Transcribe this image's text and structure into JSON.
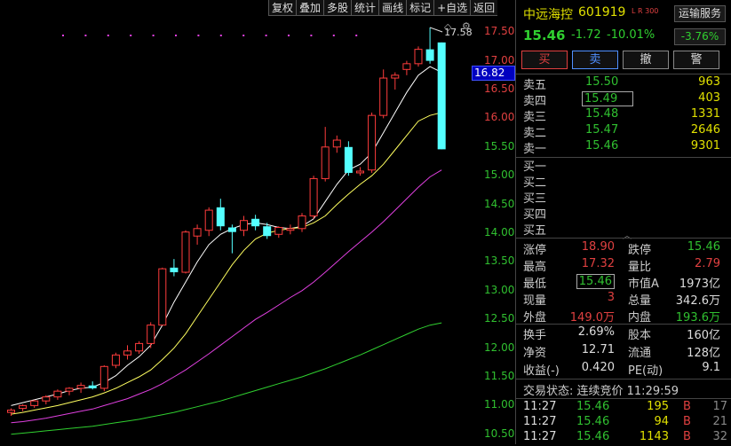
{
  "toolbar": [
    "复权",
    "叠加",
    "多股",
    "统计",
    "画线",
    "标记",
    "+自选",
    "返回"
  ],
  "y_axis": [
    {
      "label": "17.50",
      "value": 17.5
    },
    {
      "label": "17.00",
      "value": 17.0
    },
    {
      "label": "16.50",
      "value": 16.5
    },
    {
      "label": "16.00",
      "value": 16.0
    },
    {
      "label": "15.50",
      "value": 15.5
    },
    {
      "label": "15.00",
      "value": 15.0
    },
    {
      "label": "14.50",
      "value": 14.5
    },
    {
      "label": "14.00",
      "value": 14.0
    },
    {
      "label": "13.50",
      "value": 13.5
    },
    {
      "label": "13.00",
      "value": 13.0
    },
    {
      "label": "12.50",
      "value": 12.5
    },
    {
      "label": "12.00",
      "value": 12.0
    },
    {
      "label": "11.50",
      "value": 11.5
    },
    {
      "label": "11.00",
      "value": 11.0
    },
    {
      "label": "10.50",
      "value": 10.5
    }
  ],
  "current_price_label": "16.82",
  "high_marker": "17.58",
  "chart_data": {
    "type": "candlestick",
    "candles": [
      [
        10.88,
        10.95,
        10.82,
        10.92
      ],
      [
        10.95,
        11.02,
        10.9,
        11.0
      ],
      [
        11.0,
        11.1,
        10.96,
        11.08
      ],
      [
        11.08,
        11.18,
        11.02,
        11.15
      ],
      [
        11.15,
        11.28,
        11.1,
        11.25
      ],
      [
        11.25,
        11.32,
        11.18,
        11.3
      ],
      [
        11.3,
        11.4,
        11.22,
        11.35
      ],
      [
        11.35,
        11.42,
        11.28,
        11.3
      ],
      [
        11.3,
        11.7,
        11.25,
        11.68
      ],
      [
        11.7,
        11.92,
        11.65,
        11.88
      ],
      [
        11.88,
        12.05,
        11.8,
        11.95
      ],
      [
        11.95,
        12.12,
        11.9,
        12.08
      ],
      [
        12.08,
        12.45,
        12.0,
        12.4
      ],
      [
        12.4,
        13.4,
        12.4,
        13.38
      ],
      [
        13.4,
        13.55,
        13.25,
        13.32
      ],
      [
        13.32,
        14.05,
        13.3,
        14.02
      ],
      [
        13.95,
        14.15,
        13.8,
        14.08
      ],
      [
        14.05,
        14.45,
        13.95,
        14.4
      ],
      [
        14.45,
        14.6,
        14.05,
        14.12
      ],
      [
        14.1,
        14.15,
        13.65,
        14.02
      ],
      [
        14.05,
        14.3,
        13.95,
        14.22
      ],
      [
        14.25,
        14.32,
        14.05,
        14.12
      ],
      [
        14.12,
        14.18,
        13.9,
        13.95
      ],
      [
        13.98,
        14.12,
        13.92,
        14.1
      ],
      [
        14.05,
        14.15,
        13.98,
        14.08
      ],
      [
        14.08,
        14.35,
        14.02,
        14.3
      ],
      [
        14.3,
        15.0,
        14.25,
        14.95
      ],
      [
        14.95,
        15.85,
        14.9,
        15.5
      ],
      [
        15.5,
        15.7,
        15.4,
        15.62
      ],
      [
        15.5,
        15.6,
        15.0,
        15.05
      ],
      [
        15.05,
        15.15,
        15.0,
        15.08
      ],
      [
        15.1,
        16.1,
        15.05,
        16.05
      ],
      [
        16.05,
        16.85,
        16.0,
        16.7
      ],
      [
        16.7,
        16.8,
        16.5,
        16.75
      ],
      [
        16.85,
        17.0,
        16.75,
        16.95
      ],
      [
        16.95,
        17.25,
        16.9,
        17.2
      ],
      [
        17.2,
        17.58,
        16.95,
        17.0
      ],
      [
        17.32,
        17.32,
        15.46,
        15.46
      ]
    ],
    "ma": [
      {
        "name": "MA5",
        "color": "#ffffff",
        "values": [
          11.0,
          11.05,
          11.1,
          11.15,
          11.2,
          11.26,
          11.3,
          11.32,
          11.4,
          11.52,
          11.7,
          11.85,
          12.05,
          12.4,
          12.8,
          13.15,
          13.5,
          13.8,
          13.98,
          14.08,
          14.15,
          14.18,
          14.15,
          14.1,
          14.08,
          14.12,
          14.25,
          14.55,
          14.85,
          15.1,
          15.2,
          15.4,
          15.75,
          16.1,
          16.45,
          16.75,
          16.9,
          16.8
        ]
      },
      {
        "name": "MA10",
        "color": "#ffff60",
        "values": [
          10.85,
          10.88,
          10.92,
          10.96,
          11.0,
          11.05,
          11.1,
          11.15,
          11.22,
          11.3,
          11.4,
          11.5,
          11.62,
          11.8,
          12.0,
          12.25,
          12.55,
          12.85,
          13.15,
          13.45,
          13.7,
          13.9,
          14.0,
          14.05,
          14.08,
          14.1,
          14.18,
          14.3,
          14.5,
          14.68,
          14.85,
          15.0,
          15.2,
          15.45,
          15.7,
          15.95,
          16.05,
          16.1
        ]
      },
      {
        "name": "MA20",
        "color": "#e040e0",
        "values": [
          10.7,
          10.72,
          10.75,
          10.78,
          10.82,
          10.86,
          10.9,
          10.94,
          11.0,
          11.06,
          11.12,
          11.2,
          11.28,
          11.38,
          11.5,
          11.62,
          11.76,
          11.9,
          12.05,
          12.2,
          12.35,
          12.5,
          12.62,
          12.75,
          12.88,
          13.0,
          13.15,
          13.32,
          13.5,
          13.68,
          13.85,
          14.02,
          14.2,
          14.4,
          14.6,
          14.8,
          14.98,
          15.1
        ]
      },
      {
        "name": "MA60",
        "color": "#30d030",
        "values": [
          10.5,
          10.52,
          10.54,
          10.56,
          10.58,
          10.6,
          10.62,
          10.64,
          10.67,
          10.7,
          10.73,
          10.76,
          10.8,
          10.84,
          10.88,
          10.93,
          10.98,
          11.03,
          11.08,
          11.14,
          11.2,
          11.26,
          11.32,
          11.38,
          11.44,
          11.5,
          11.57,
          11.64,
          11.72,
          11.8,
          11.88,
          11.97,
          12.06,
          12.15,
          12.24,
          12.33,
          12.4,
          12.44
        ]
      }
    ],
    "ylim": [
      10.45,
      17.75
    ]
  },
  "stock": {
    "name": "中远海控",
    "code": "601919",
    "tags": "L R 300",
    "industry": "运输服务",
    "industry_pct": "-3.76%"
  },
  "quote": {
    "price": "15.46",
    "change": "-1.72",
    "pct": "-10.01%"
  },
  "buttons": [
    "买",
    "卖",
    "撤",
    "警"
  ],
  "sell_orders": [
    {
      "label": "卖五",
      "price": "15.50",
      "vol": "963"
    },
    {
      "label": "卖四",
      "price": "15.49",
      "vol": "403"
    },
    {
      "label": "卖三",
      "price": "15.48",
      "vol": "1331"
    },
    {
      "label": "卖二",
      "price": "15.47",
      "vol": "2646"
    },
    {
      "label": "卖一",
      "price": "15.46",
      "vol": "9301"
    }
  ],
  "buy_orders": [
    "买一",
    "买二",
    "买三",
    "买四",
    "买五"
  ],
  "stats": [
    {
      "l1": "涨停",
      "v1": "18.90",
      "c1": "red",
      "l2": "跌停",
      "v2": "15.46",
      "c2": "val"
    },
    {
      "l1": "最高",
      "v1": "17.32",
      "c1": "red",
      "l2": "量比",
      "v2": "2.79",
      "c2": "red"
    },
    {
      "l1": "最低",
      "v1": "15.46",
      "c1": "val",
      "l2": "市值A",
      "v2": "1973亿",
      "c2": "wht"
    },
    {
      "l1": "现量",
      "v1": "3",
      "c1": "red",
      "l2": "总量",
      "v2": "342.6万",
      "c2": "wht"
    },
    {
      "l1": "外盘",
      "v1": "149.0万",
      "c1": "red",
      "l2": "内盘",
      "v2": "193.6万",
      "c2": "val"
    }
  ],
  "stats2": [
    {
      "l1": "换手",
      "v1": "2.69%",
      "l2": "股本",
      "v2": "160亿"
    },
    {
      "l1": "净资",
      "v1": "12.71",
      "l2": "流通",
      "v2": "128亿"
    },
    {
      "l1": "收益(-)",
      "v1": "0.420",
      "l2": "PE(动)",
      "v2": "9.1"
    }
  ],
  "trade_status": "交易状态: 连续竞价 11:29:59",
  "ticks": [
    {
      "time": "11:27",
      "price": "15.46",
      "vol": "195",
      "side": "B",
      "n": "17"
    },
    {
      "time": "11:27",
      "price": "15.46",
      "vol": "94",
      "side": "B",
      "n": "21"
    },
    {
      "time": "11:27",
      "price": "15.46",
      "vol": "1143",
      "side": "B",
      "n": "32"
    }
  ]
}
